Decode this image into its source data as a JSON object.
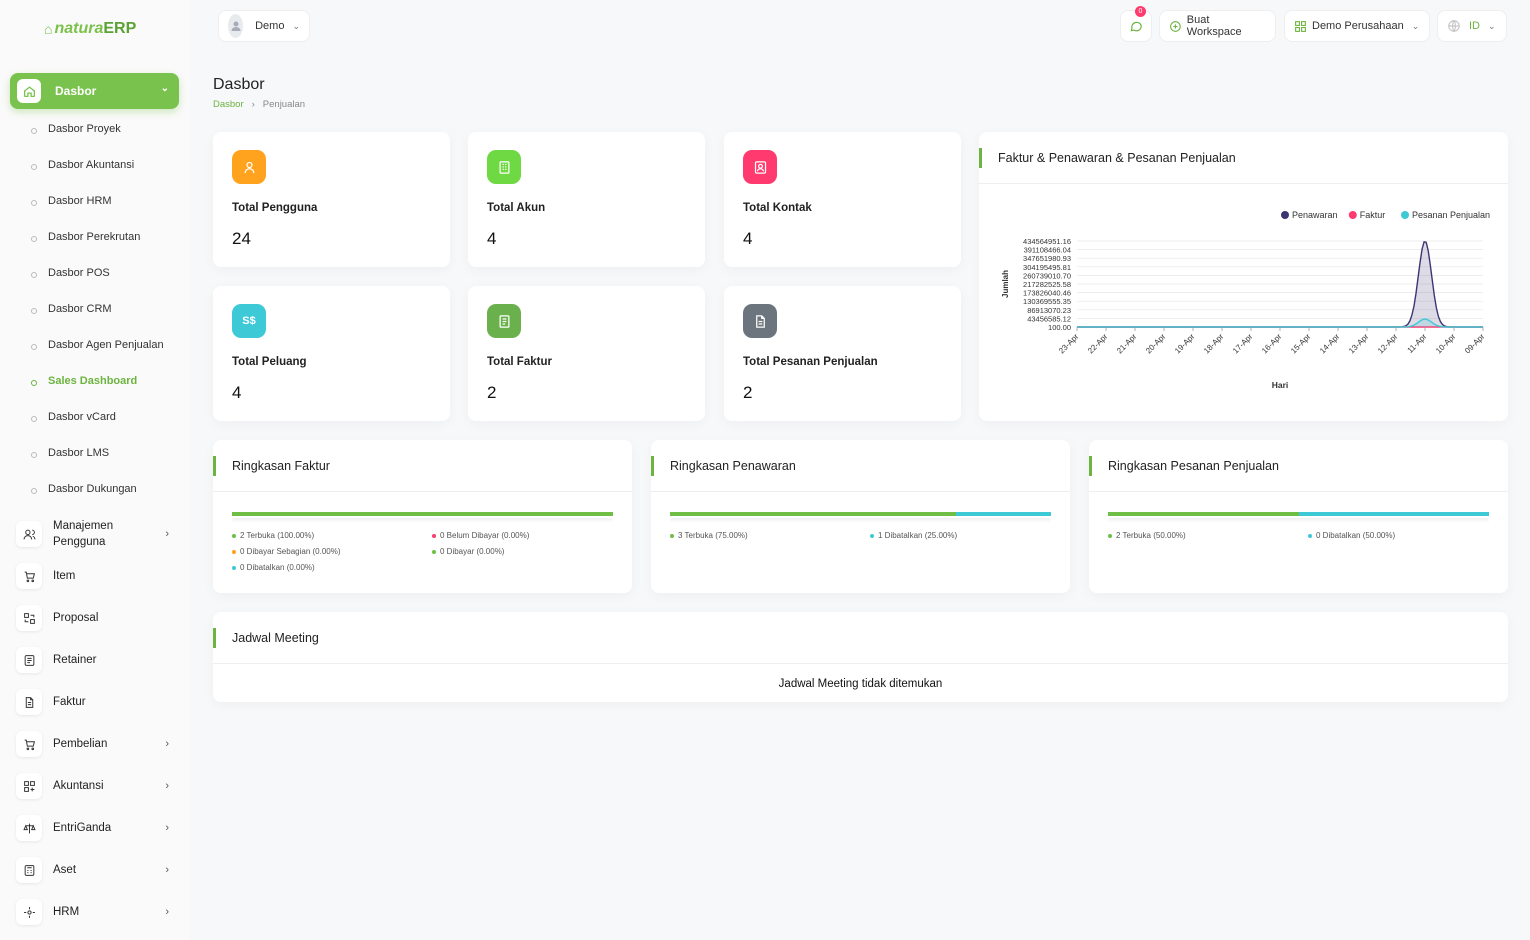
{
  "brand": {
    "part1": "natura",
    "part2": "ERP"
  },
  "sidebar": {
    "active": {
      "label": "Dasbor"
    },
    "submenu": [
      "Dasbor Proyek",
      "Dasbor Akuntansi",
      "Dasbor HRM",
      "Dasbor Perekrutan",
      "Dasbor POS",
      "Dasbor CRM",
      "Dasbor Agen Penjualan",
      "Sales Dashboard",
      "Dasbor vCard",
      "Dasbor LMS",
      "Dasbor Dukungan"
    ],
    "menu": [
      {
        "label": "Manajemen Pengguna",
        "icon": "users-icon",
        "has_children": true
      },
      {
        "label": "Item",
        "icon": "cart-icon",
        "has_children": false
      },
      {
        "label": "Proposal",
        "icon": "exchange-icon",
        "has_children": false
      },
      {
        "label": "Retainer",
        "icon": "retainer-icon",
        "has_children": false
      },
      {
        "label": "Faktur",
        "icon": "file-icon",
        "has_children": false
      },
      {
        "label": "Pembelian",
        "icon": "shopping-cart-icon",
        "has_children": true
      },
      {
        "label": "Akuntansi",
        "icon": "grid-icon",
        "has_children": true
      },
      {
        "label": "EntriGanda",
        "icon": "scale-icon",
        "has_children": true
      },
      {
        "label": "Aset",
        "icon": "calculator-icon",
        "has_children": true
      },
      {
        "label": "HRM",
        "icon": "hrm-icon",
        "has_children": true
      }
    ]
  },
  "topbar": {
    "user": "Demo",
    "notification_count": "0",
    "workspace_button": "Buat Workspace",
    "company": "Demo Perusahaan",
    "language": "ID"
  },
  "page": {
    "title": "Dasbor",
    "breadcrumb": [
      "Dasbor",
      "Penjualan"
    ]
  },
  "stats": [
    {
      "label": "Total Pengguna",
      "value": "24",
      "icon": "user-icon",
      "color": "#ffa21d"
    },
    {
      "label": "Total Akun",
      "value": "4",
      "icon": "building-icon",
      "color": "#6fd943"
    },
    {
      "label": "Total Kontak",
      "value": "4",
      "icon": "contact-icon",
      "color": "#ff3a6e"
    },
    {
      "label": "Total Peluang",
      "value": "4",
      "icon": "money-icon",
      "icon_text": "S$",
      "color": "#3ec9d6"
    },
    {
      "label": "Total Faktur",
      "value": "2",
      "icon": "invoice-icon",
      "color": "#6ab04c"
    },
    {
      "label": "Total Pesanan Penjualan",
      "value": "2",
      "icon": "document-icon",
      "color": "#6c757d"
    }
  ],
  "chart_card": {
    "title": "Faktur & Penawaran & Pesanan Penjualan"
  },
  "chart_data": {
    "type": "area",
    "title": "",
    "xlabel": "Hari",
    "ylabel": "Jumlah",
    "categories": [
      "23-Apr",
      "22-Apr",
      "21-Apr",
      "20-Apr",
      "19-Apr",
      "18-Apr",
      "17-Apr",
      "16-Apr",
      "15-Apr",
      "14-Apr",
      "13-Apr",
      "12-Apr",
      "11-Apr",
      "10-Apr",
      "09-Apr"
    ],
    "y_ticks": [
      "434564951.16",
      "391108466.04",
      "347651980.93",
      "304195495.81",
      "260739010.70",
      "217282525.58",
      "173826040.46",
      "130369555.35",
      "86913070.23",
      "43456585.12",
      "100.00"
    ],
    "ylim": [
      100,
      434564951.16
    ],
    "series": [
      {
        "name": "Penawaran",
        "color": "#3c3574",
        "values": [
          0,
          0,
          0,
          0,
          0,
          0,
          0,
          0,
          0,
          0,
          0,
          0,
          434564951.16,
          0,
          0
        ]
      },
      {
        "name": "Faktur",
        "color": "#ff3a6e",
        "values": [
          0,
          0,
          0,
          0,
          0,
          0,
          0,
          0,
          0,
          0,
          0,
          0,
          0,
          0,
          0
        ]
      },
      {
        "name": "Pesanan Penjualan",
        "color": "#3ec9d6",
        "values": [
          0,
          0,
          0,
          0,
          0,
          0,
          0,
          0,
          0,
          0,
          0,
          0,
          40000000,
          0,
          0
        ]
      }
    ],
    "legend_position": "top-right",
    "grid": true
  },
  "summaries": [
    {
      "title": "Ringkasan Faktur",
      "segments": [
        {
          "color": "#6fbf47",
          "fraction": 1.0
        }
      ],
      "items": [
        {
          "text": "2 Terbuka (100.00%)",
          "color": "#6fbf47"
        },
        {
          "text": "0 Belum Dibayar (0.00%)",
          "color": "#ff3a6e"
        },
        {
          "text": "0 Dibayar Sebagian (0.00%)",
          "color": "#ffa21d"
        },
        {
          "text": "0 Dibayar (0.00%)",
          "color": "#6fbf47"
        },
        {
          "text": "0 Dibatalkan (0.00%)",
          "color": "#3ec9d6"
        }
      ]
    },
    {
      "title": "Ringkasan Penawaran",
      "segments": [
        {
          "color": "#6fbf47",
          "fraction": 0.75
        },
        {
          "color": "#3ec9d6",
          "fraction": 0.25
        }
      ],
      "items": [
        {
          "text": "3 Terbuka (75.00%)",
          "color": "#6fbf47"
        },
        {
          "text": "1 Dibatalkan (25.00%)",
          "color": "#3ec9d6"
        }
      ]
    },
    {
      "title": "Ringkasan Pesanan Penjualan",
      "segments": [
        {
          "color": "#6fbf47",
          "fraction": 0.5
        },
        {
          "color": "#3ec9d6",
          "fraction": 0.5
        }
      ],
      "items": [
        {
          "text": "2 Terbuka (50.00%)",
          "color": "#6fbf47"
        },
        {
          "text": "0 Dibatalkan (50.00%)",
          "color": "#3ec9d6"
        }
      ]
    }
  ],
  "meetings": {
    "title": "Jadwal Meeting",
    "empty": "Jadwal Meeting tidak ditemukan"
  }
}
